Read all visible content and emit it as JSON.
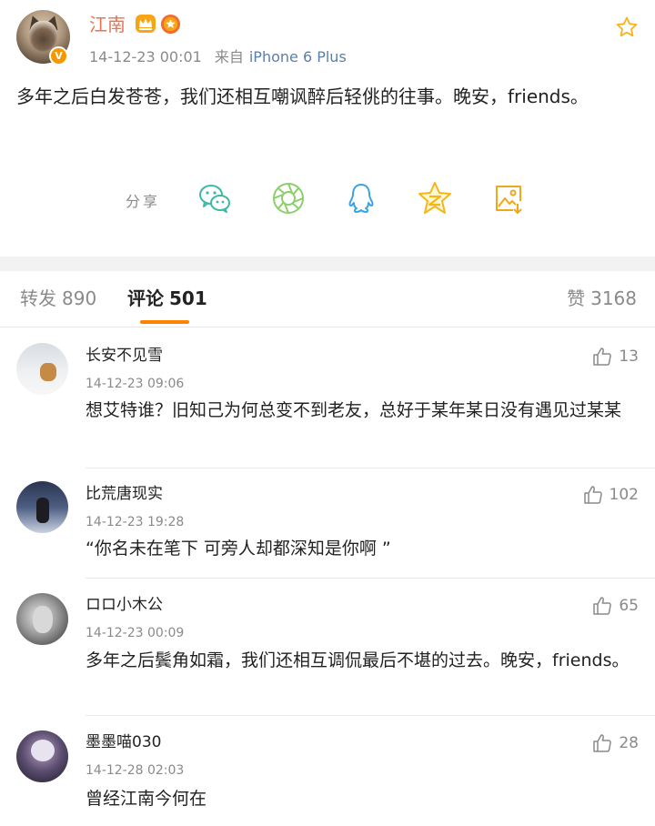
{
  "post": {
    "author": "江南",
    "timestamp": "14-12-23 00:01",
    "source_prefix": "来自",
    "source": "iPhone 6 Plus",
    "text": "多年之后白发苍苍，我们还相互嘲讽醉后轻佻的往事。晚安，friends。",
    "vip_badge": "V",
    "share_label": "分享",
    "share_targets": [
      "wechat-icon",
      "moments-icon",
      "qq-icon",
      "qzone-icon",
      "save-image-icon"
    ],
    "accent_color": "#eb7350",
    "share_color": "#3fb9a6"
  },
  "tabs": {
    "repost_label": "转发",
    "repost_count": "890",
    "comment_label": "评论",
    "comment_count": "501",
    "like_label": "赞",
    "like_count": "3168",
    "active_color": "#ff8200"
  },
  "comments": [
    {
      "name": "长安不见雪",
      "time": "14-12-23 09:06",
      "likes": "13",
      "text": "想艾特谁？旧知己为何总变不到老友，总好于某年某日没有遇见过某某"
    },
    {
      "name": "比荒唐现实",
      "time": "14-12-23 19:28",
      "likes": "102",
      "text": "“你名未在笔下  可旁人却都深知是你啊 ”"
    },
    {
      "name": "ロロ小木公",
      "time": "14-12-23 00:09",
      "likes": "65",
      "text": "多年之后鬓角如霜，我们还相互调侃最后不堪的过去。晚安，friends。"
    },
    {
      "name": "墨墨喵030",
      "time": "14-12-28 02:03",
      "likes": "28",
      "text": "曾经江南今何在"
    }
  ]
}
